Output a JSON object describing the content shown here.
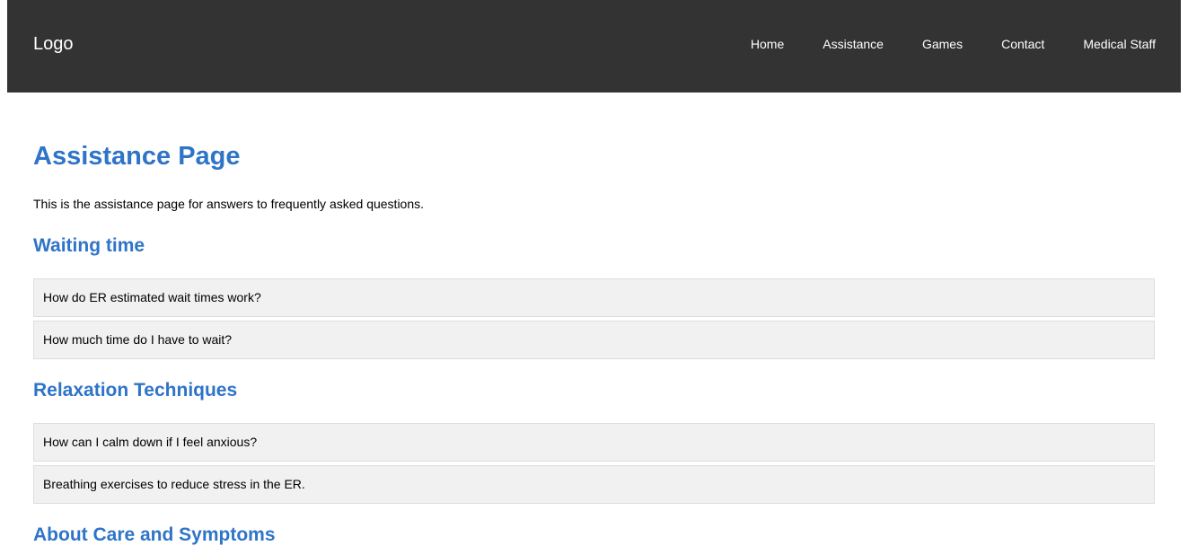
{
  "header": {
    "logo": "Logo",
    "nav": [
      "Home",
      "Assistance",
      "Games",
      "Contact",
      "Medical Staff"
    ]
  },
  "page": {
    "title": "Assistance Page",
    "intro": "This is the assistance page for answers to frequently asked questions."
  },
  "sections": [
    {
      "title": "Waiting time",
      "questions": [
        "How do ER estimated wait times work?",
        "How much time do I have to wait?"
      ]
    },
    {
      "title": "Relaxation Techniques",
      "questions": [
        "How can I calm down if I feel anxious?",
        "Breathing exercises to reduce stress in the ER."
      ]
    },
    {
      "title": "About Care and Symptoms",
      "questions": []
    }
  ],
  "colors": {
    "header_bg": "#333333",
    "heading": "#2e74c7",
    "faq_bg": "#f1f1f1",
    "faq_border": "#dddddd"
  }
}
